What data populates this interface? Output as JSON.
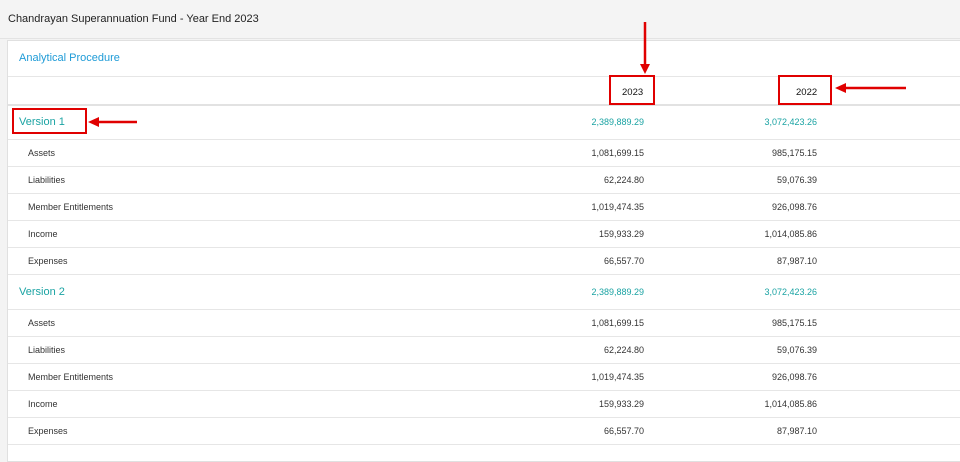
{
  "page": {
    "title": "Chandrayan Superannuation Fund - Year End 2023"
  },
  "card": {
    "heading": "Analytical Procedure"
  },
  "columns": {
    "year_1": "2023",
    "year_2": "2022"
  },
  "versions": [
    {
      "label": "Version 1",
      "total_1": "2,389,889.29",
      "total_2": "3,072,423.26",
      "items": [
        {
          "label": "Assets",
          "v1": "1,081,699.15",
          "v2": "985,175.15"
        },
        {
          "label": "Liabilities",
          "v1": "62,224.80",
          "v2": "59,076.39"
        },
        {
          "label": "Member Entitlements",
          "v1": "1,019,474.35",
          "v2": "926,098.76"
        },
        {
          "label": "Income",
          "v1": "159,933.29",
          "v2": "1,014,085.86"
        },
        {
          "label": "Expenses",
          "v1": "66,557.70",
          "v2": "87,987.10"
        }
      ]
    },
    {
      "label": "Version 2",
      "total_1": "2,389,889.29",
      "total_2": "3,072,423.26",
      "items": [
        {
          "label": "Assets",
          "v1": "1,081,699.15",
          "v2": "985,175.15"
        },
        {
          "label": "Liabilities",
          "v1": "62,224.80",
          "v2": "59,076.39"
        },
        {
          "label": "Member Entitlements",
          "v1": "1,019,474.35",
          "v2": "926,098.76"
        },
        {
          "label": "Income",
          "v1": "159,933.29",
          "v2": "1,014,085.86"
        },
        {
          "label": "Expenses",
          "v1": "66,557.70",
          "v2": "87,987.10"
        }
      ]
    }
  ],
  "colors": {
    "accent": "#1e9bd7",
    "version": "#1aa3a3",
    "annotation": "#e00000"
  }
}
